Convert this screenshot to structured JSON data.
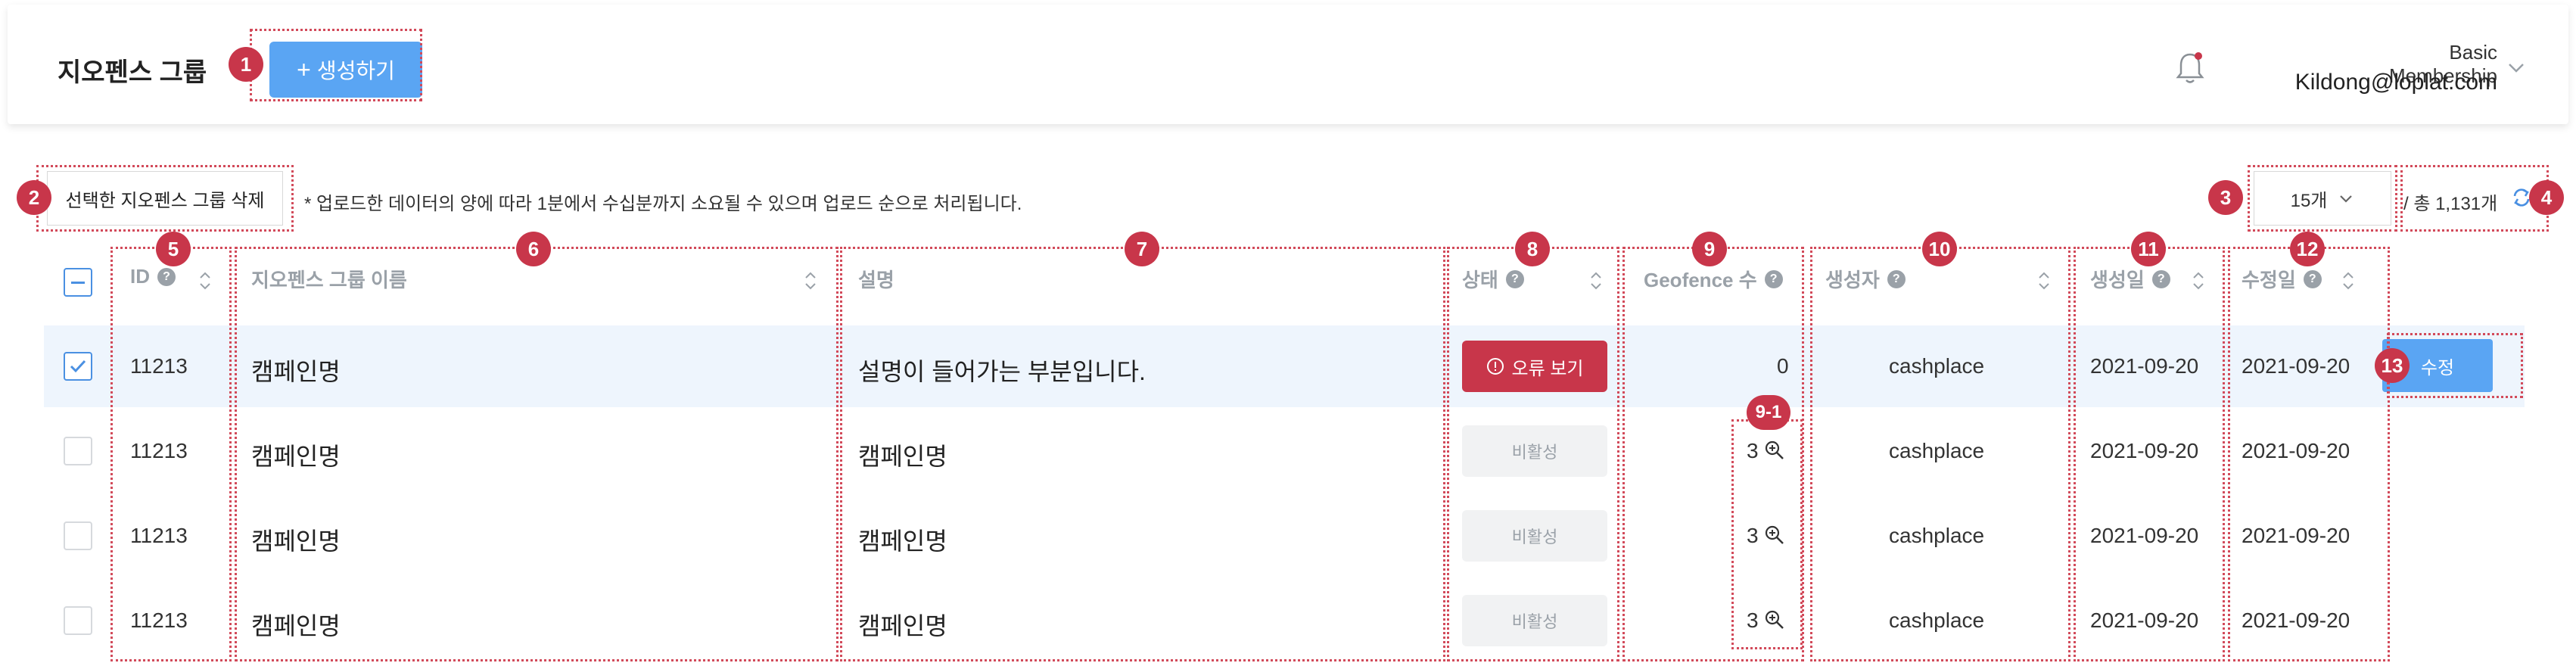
{
  "header": {
    "title": "지오펜스 그룹",
    "create_button": "생성하기",
    "create_icon": "+",
    "membership": "Basic Membership",
    "email": "Kildong@loplat.com"
  },
  "toolbar": {
    "delete_button": "선택한 지오펜스 그룹 삭제",
    "notice": "* 업로드한 데이터의 양에 따라 1분에서 수십분까지 소요될 수 있으며 업로드 순으로 처리됩니다.",
    "page_size": "15개",
    "total": "/ 총 1,131개"
  },
  "columns": {
    "id": "ID",
    "name": "지오펜스 그룹 이름",
    "desc": "설명",
    "status": "상태",
    "geofence": "Geofence 수",
    "creator": "생성자",
    "created": "생성일",
    "modified": "수정일",
    "help": "?"
  },
  "rows": [
    {
      "id": "11213",
      "name": "캠페인명",
      "desc": "설명이 들어가는 부분입니다.",
      "status": "오류 보기",
      "count": "0",
      "creator": "cashplace",
      "created": "2021-09-20",
      "modified": "2021-09-20",
      "checked": true
    },
    {
      "id": "11213",
      "name": "캠페인명",
      "desc": "캠페인명",
      "status": "비활성",
      "count": "3",
      "creator": "cashplace",
      "created": "2021-09-20",
      "modified": "2021-09-20",
      "checked": false
    },
    {
      "id": "11213",
      "name": "캠페인명",
      "desc": "캠페인명",
      "status": "비활성",
      "count": "3",
      "creator": "cashplace",
      "created": "2021-09-20",
      "modified": "2021-09-20",
      "checked": false
    },
    {
      "id": "11213",
      "name": "캠페인명",
      "desc": "캠페인명",
      "status": "비활성",
      "count": "3",
      "creator": "cashplace",
      "created": "2021-09-20",
      "modified": "2021-09-20",
      "checked": false
    }
  ],
  "edit_button": "수정",
  "badges": [
    "1",
    "2",
    "3",
    "4",
    "5",
    "6",
    "7",
    "8",
    "9",
    "9-1",
    "10",
    "11",
    "12",
    "13"
  ],
  "icons": {
    "bell": "bell-icon",
    "chevron": "chevron-down-icon",
    "refresh": "refresh-icon",
    "sort": "sort-icon",
    "help": "help-icon",
    "error": "error-icon",
    "zoom": "zoom-in-icon",
    "check": "check-icon"
  },
  "colors": {
    "primary": "#5aa5f3",
    "danger": "#c8364a",
    "selected_row": "#eef5fd",
    "annotation": "#d24a5a",
    "muted": "#9aa1a8"
  }
}
